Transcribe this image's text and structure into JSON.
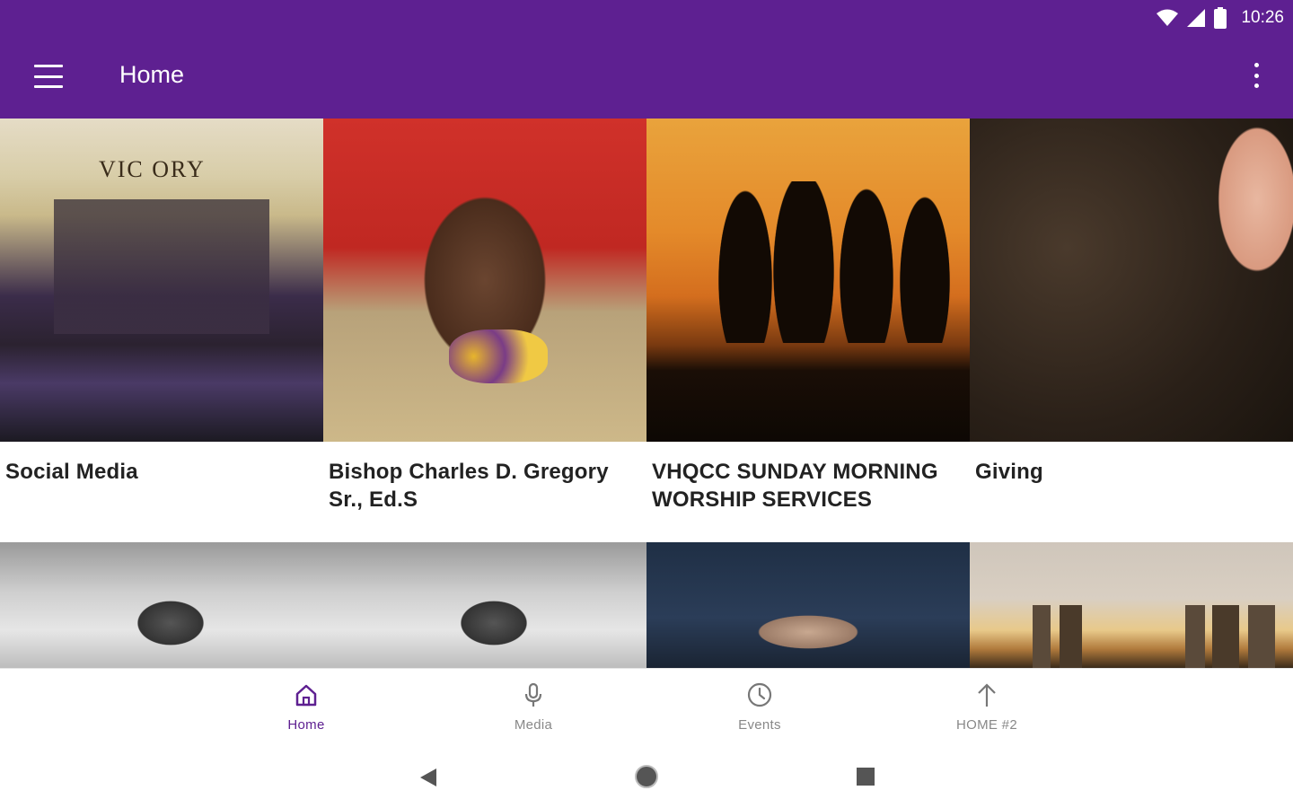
{
  "status_bar": {
    "time": "10:26"
  },
  "toolbar": {
    "title": "Home"
  },
  "tiles": [
    {
      "title": "Social Media",
      "image_label": "VIC ORY"
    },
    {
      "title": "Bishop Charles D. Gregory Sr., Ed.S"
    },
    {
      "title": "VHQCC SUNDAY MORNING WORSHIP SERVICES"
    },
    {
      "title": "Giving"
    }
  ],
  "bottom_nav": [
    {
      "label": "Home",
      "icon": "home-icon",
      "active": true
    },
    {
      "label": "Media",
      "icon": "microphone-icon",
      "active": false
    },
    {
      "label": "Events",
      "icon": "clock-icon",
      "active": false
    },
    {
      "label": "HOME #2",
      "icon": "arrow-up-icon",
      "active": false
    }
  ],
  "colors": {
    "primary": "#5e2091",
    "inactive": "#888888"
  }
}
